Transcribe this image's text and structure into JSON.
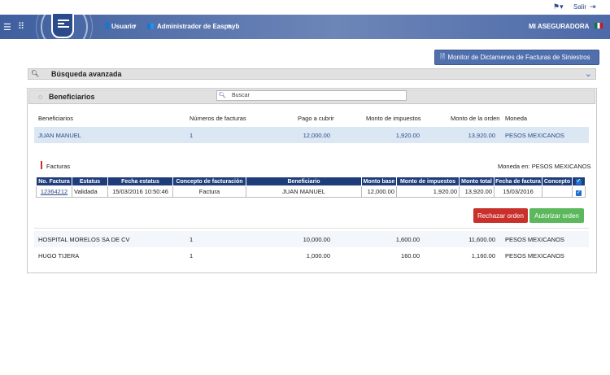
{
  "topbar": {
    "salir_label": "Salir"
  },
  "navbar": {
    "user_label": "Usuario",
    "admin_label": "Administrador de Easpayb",
    "company_label": "MI ASEGURADORA"
  },
  "monitor_button": {
    "label": "Monitor de Dictamenes de Facturas de Siniestros"
  },
  "advanced_search": {
    "title": "Búsqueda avanzada"
  },
  "beneficiaries": {
    "title": "Beneficiarios",
    "search_placeholder": "Buscar",
    "columns": [
      "Beneficiarios",
      "Números de facturas",
      "Pago a cubrir",
      "Monto de impuestos",
      "Monto de la orden",
      "Moneda"
    ],
    "rows": [
      {
        "name": "JUAN MANUEL",
        "facturas": "1",
        "pago": "12,000.00",
        "impuestos": "1,920.00",
        "orden": "13,920.00",
        "moneda": "PESOS MEXICANOS"
      },
      {
        "name": "HOSPITAL MORELOS SA DE CV",
        "facturas": "1",
        "pago": "10,000.00",
        "impuestos": "1,600.00",
        "orden": "11,600.00",
        "moneda": "PESOS MEXICANOS"
      },
      {
        "name": "HUGO TIJERA",
        "facturas": "1",
        "pago": "1,000.00",
        "impuestos": "160.00",
        "orden": "1,160.00",
        "moneda": "PESOS MEXICANOS"
      }
    ]
  },
  "facturas": {
    "title": "Facturas",
    "currency_note": "Moneda en: PESOS MEXICANOS",
    "columns": [
      "No. Factura",
      "Estatus",
      "Fecha estatus",
      "Concepto de facturación",
      "Beneficiario",
      "Monto base",
      "Monto de impuestos",
      "Monto total",
      "Fecha de factura",
      "Concepto"
    ],
    "row": {
      "numero": "12364212",
      "estatus": "Validada",
      "fecha_estatus": "15/03/2016 10:50:46",
      "concepto_facturacion": "Factura",
      "beneficiario": "JUAN MANUEL",
      "monto_base": "12,000.00",
      "monto_impuestos": "1,920.00",
      "monto_total": "13,920.00",
      "fecha_factura": "15/03/2016",
      "concepto": ""
    },
    "reject_label": "Rechazar orden",
    "authorize_label": "Autorizar orden"
  },
  "colors": {
    "navbar": "#4d6aa8",
    "table_header": "#1f3d7a",
    "selected_row": "#dbe8f4",
    "reject": "#c9302c",
    "authorize": "#5cb85c"
  }
}
